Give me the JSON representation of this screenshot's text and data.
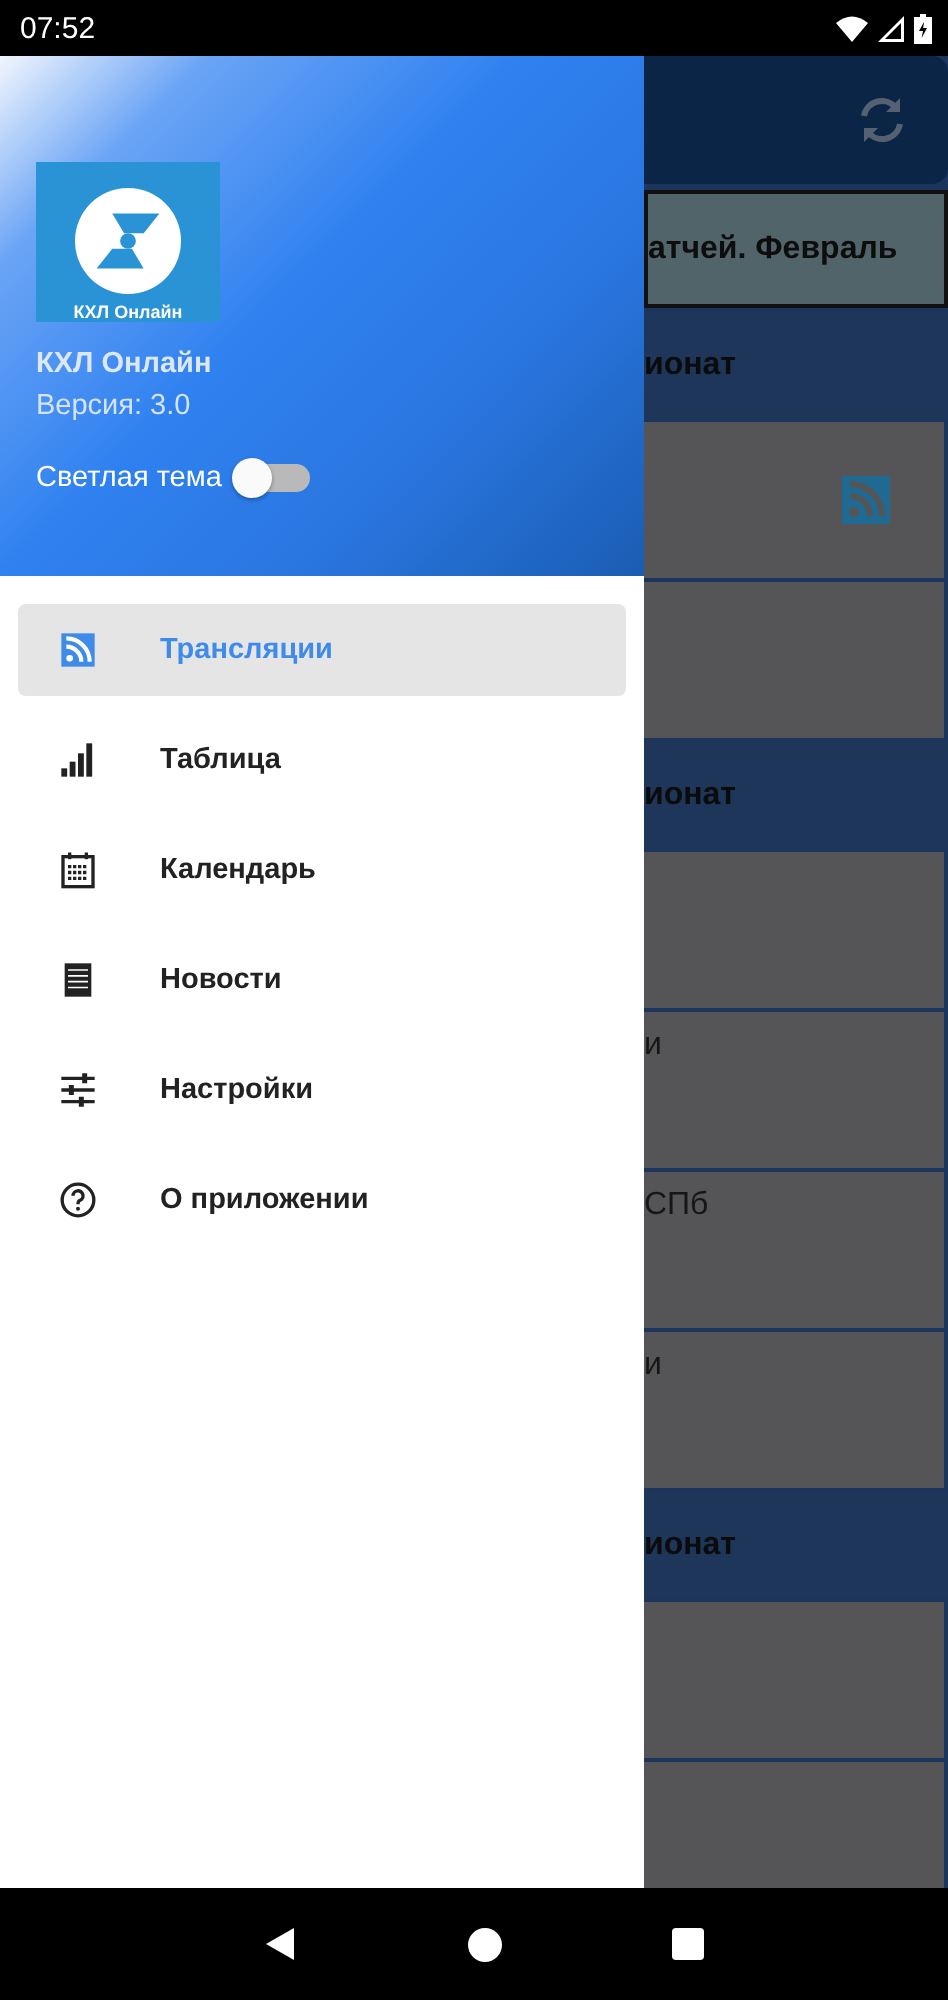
{
  "status_bar": {
    "time": "07:52"
  },
  "drawer": {
    "header": {
      "logo_caption": "КХЛ Онлайн",
      "app_name": "КХЛ Онлайн",
      "version": "Версия: 3.0",
      "theme_toggle": {
        "label": "Светлая тема",
        "on": false
      }
    },
    "items": [
      {
        "kind": "rss",
        "label": "Трансляции",
        "selected": true
      },
      {
        "kind": "bars",
        "label": "Таблица",
        "selected": false
      },
      {
        "kind": "calendar",
        "label": "Календарь",
        "selected": false
      },
      {
        "kind": "list",
        "label": "Новости",
        "selected": false
      },
      {
        "kind": "sliders",
        "label": "Настройки",
        "selected": false
      },
      {
        "kind": "help",
        "label": "О приложении",
        "selected": false
      }
    ]
  },
  "background": {
    "rows": [
      {
        "kind": "appbar"
      },
      {
        "kind": "banner",
        "text": "атчей. Февраль"
      },
      {
        "kind": "section",
        "text": "ионат"
      },
      {
        "kind": "feed"
      },
      {
        "kind": "card"
      },
      {
        "kind": "section",
        "text": "ионат"
      },
      {
        "kind": "card"
      },
      {
        "kind": "card",
        "text": "и"
      },
      {
        "kind": "card",
        "text": "СПб"
      },
      {
        "kind": "card",
        "text": "и"
      },
      {
        "kind": "section",
        "text": "ионат"
      },
      {
        "kind": "card"
      },
      {
        "kind": "card"
      }
    ]
  }
}
